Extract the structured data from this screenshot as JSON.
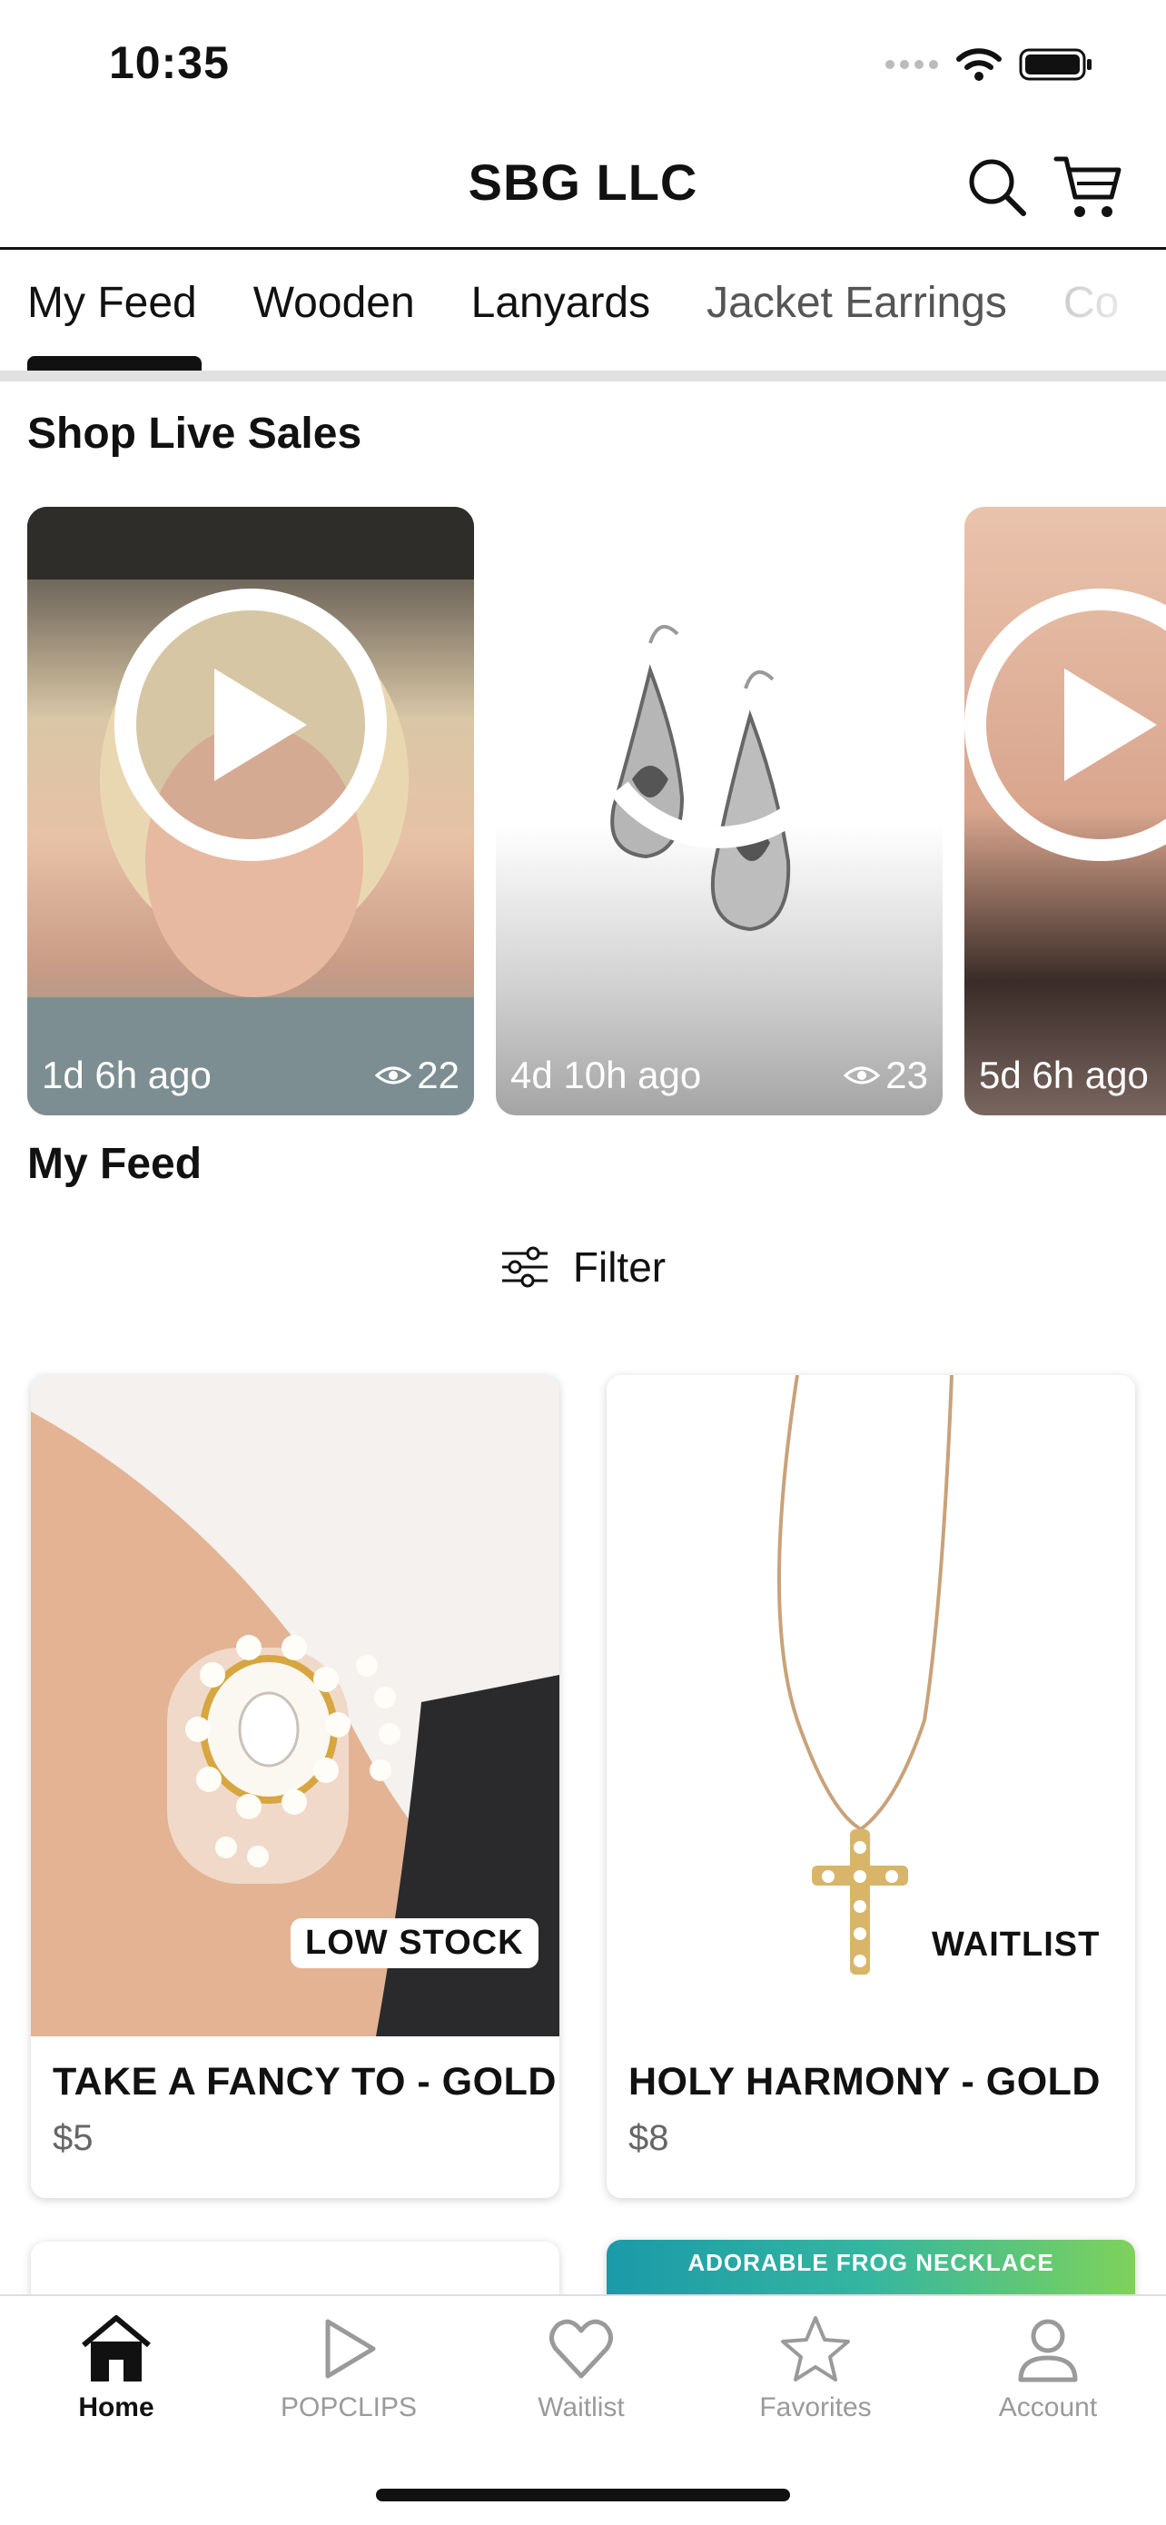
{
  "status_bar": {
    "time": "10:35"
  },
  "header": {
    "title": "SBG LLC"
  },
  "tabs": [
    {
      "label": "My Feed"
    },
    {
      "label": "Wooden"
    },
    {
      "label": "Lanyards"
    },
    {
      "label": "Jacket Earrings"
    },
    {
      "label": "Co"
    }
  ],
  "live_section": {
    "title": "Shop Live Sales",
    "cards": [
      {
        "time": "1d 6h ago",
        "views": "22"
      },
      {
        "time": "4d 10h ago",
        "views": "23"
      },
      {
        "time": "5d 6h ago",
        "views": ""
      }
    ]
  },
  "feed": {
    "title": "My Feed",
    "filter_label": "Filter",
    "products": [
      {
        "name": "TAKE A FANCY TO - GOLD",
        "price": "$5",
        "badge": "LOW STOCK"
      },
      {
        "name": "HOLY HARMONY - GOLD",
        "price": "$8",
        "badge": "WAITLIST"
      }
    ],
    "next_banner": "ADORABLE FROG NECKLACE"
  },
  "bottom_nav": [
    {
      "label": "Home"
    },
    {
      "label": "POPCLIPS"
    },
    {
      "label": "Waitlist"
    },
    {
      "label": "Favorites"
    },
    {
      "label": "Account"
    }
  ]
}
